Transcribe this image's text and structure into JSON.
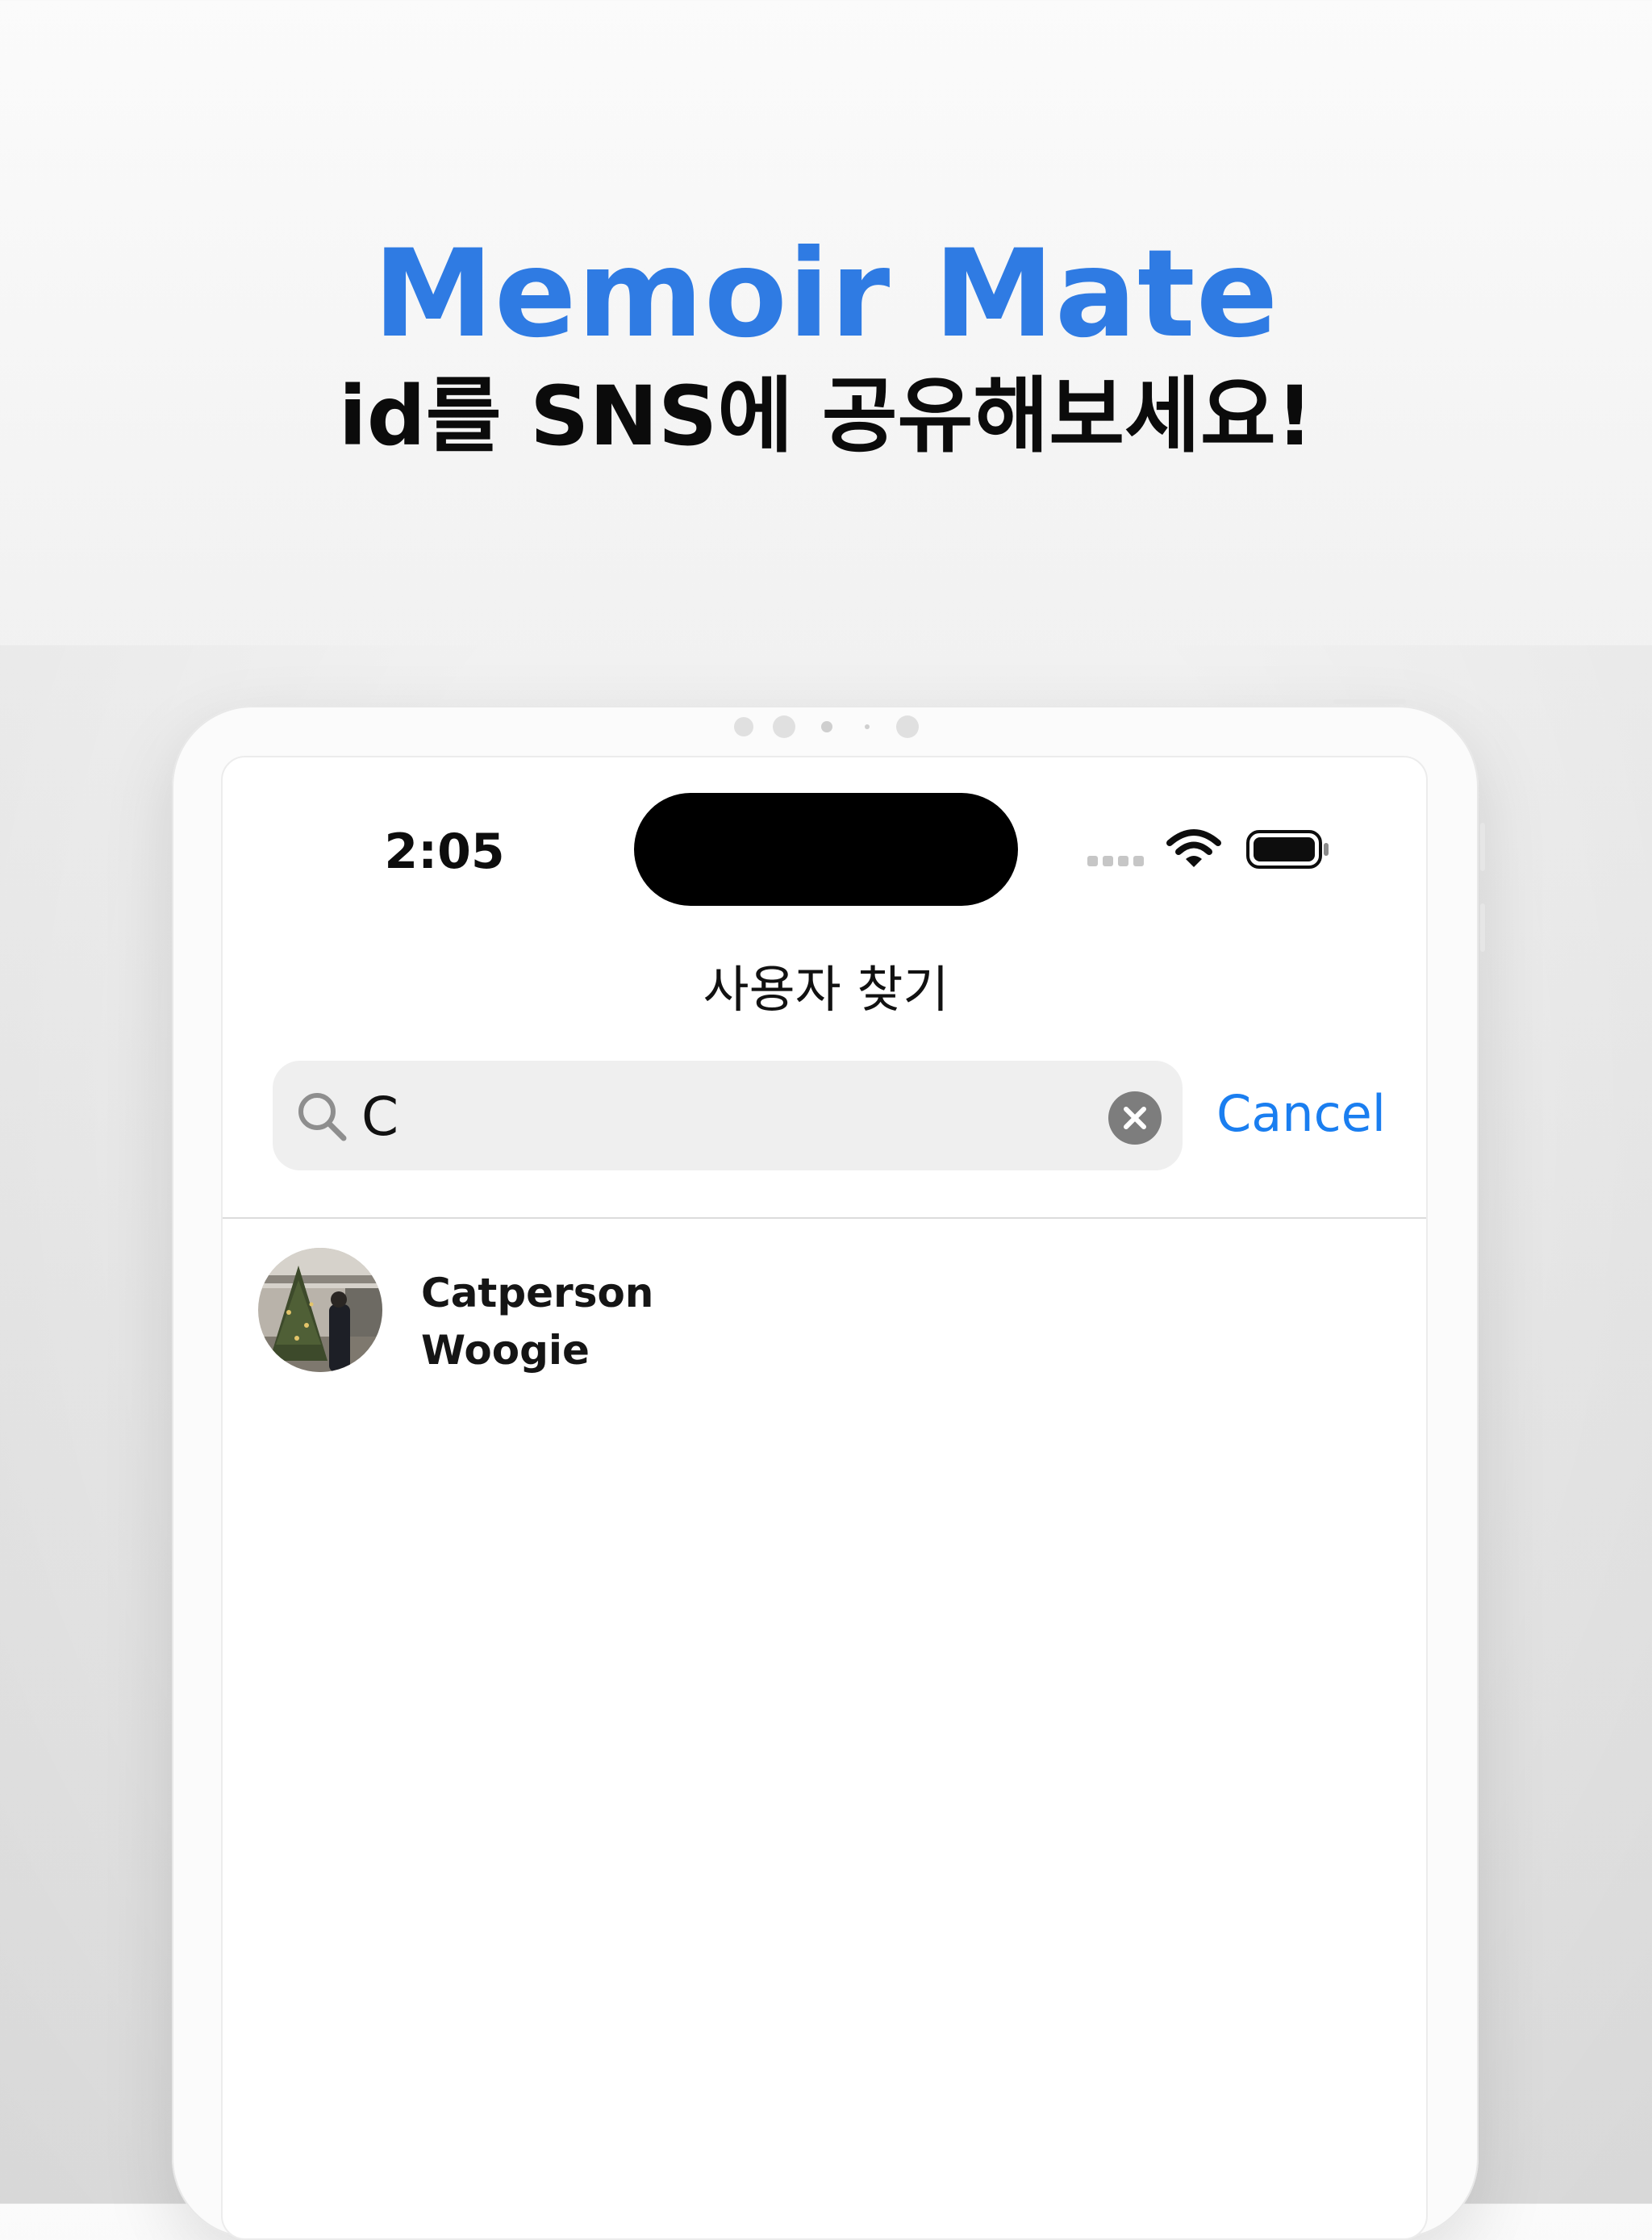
{
  "promo": {
    "app_name": "Memoir Mate",
    "tagline": "id를 SNS에 공유해보세요!"
  },
  "status_bar": {
    "time": "2:05"
  },
  "nav": {
    "title": "사용자 찾기"
  },
  "search": {
    "value": "C",
    "cancel_label": "Cancel"
  },
  "results": [
    {
      "name": "Catperson",
      "subtitle": "Woogie",
      "avatar": "profile-photo-christmas-tree"
    }
  ],
  "colors": {
    "brand_blue": "#2f7be3",
    "link_blue": "#1a7ef0",
    "search_bg": "#efefef",
    "clear_button": "#7d7d7d"
  },
  "icons": {
    "search": "search-icon",
    "clear": "clear-icon",
    "wifi": "wifi-icon",
    "battery": "battery-icon"
  }
}
